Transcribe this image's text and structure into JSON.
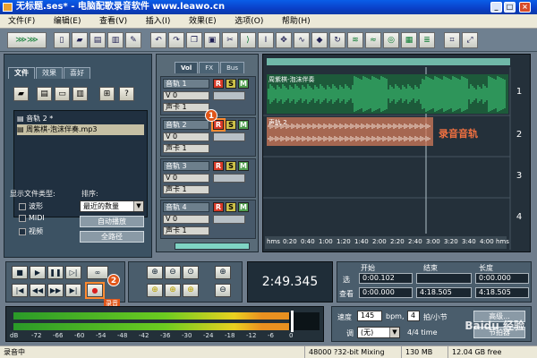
{
  "window": {
    "title": "无标题.ses* - 电脑配歌录音软件 www.leawo.cn",
    "min": "_",
    "max": "□",
    "close": "×"
  },
  "menu": [
    "文件(F)",
    "编辑(E)",
    "查看(V)",
    "插入(I)",
    "效果(E)",
    "选项(O)",
    "帮助(H)"
  ],
  "left_panel": {
    "tabs": [
      "文件",
      "效果",
      "喜好"
    ],
    "files": [
      "音轨 2 *",
      "周紫棋-泡沫伴奏.mp3"
    ],
    "show_type_label": "显示文件类型:",
    "sort_label": "排序:",
    "types": [
      "波形",
      "MIDI",
      "视频"
    ],
    "sort_value": "最近的数量",
    "btn_auto_play": "自动播放",
    "btn_full_path": "全路径"
  },
  "tracks_panel": {
    "tabs": [
      "Vol",
      "FX",
      "Bus"
    ],
    "tracks": [
      {
        "name": "音轨 1",
        "vol": "V 0",
        "out": "声卡 1"
      },
      {
        "name": "音轨 2",
        "vol": "V 0",
        "out": "声卡 1"
      },
      {
        "name": "音轨 3",
        "vol": "V 0",
        "out": "声卡 1"
      },
      {
        "name": "音轨 4",
        "vol": "V 0",
        "out": "声卡 1"
      }
    ],
    "r": "R",
    "s": "S",
    "m": "M"
  },
  "wave_panel": {
    "clip1_label": "周紫棋-泡沫伴奏",
    "clip2_label": "声轨 2",
    "record_track_label": "录音音轨",
    "lane_numbers": [
      "1",
      "2",
      "3",
      "4"
    ],
    "ruler": [
      "hms",
      "0:20",
      "0:40",
      "1:00",
      "1:20",
      "1:40",
      "2:00",
      "2:20",
      "2:40",
      "3:00",
      "3:20",
      "3:40",
      "4:00",
      "hms"
    ]
  },
  "markers": {
    "m1": "1",
    "m2": "2"
  },
  "transport": {
    "record_tooltip": "录音"
  },
  "time_display": "2:49.345",
  "selection": {
    "headers": [
      "开始",
      "结束",
      "长度"
    ],
    "row1_label": "选",
    "row2_label": "查看",
    "sel_start": "0:00.102",
    "sel_end": "",
    "sel_len": "0:00.000",
    "view_start": "0:00.000",
    "view_end": "4:18.505",
    "view_len": "4:18.505"
  },
  "bpm": {
    "tempo_label": "速度",
    "tempo_value": "145",
    "tempo_unit": "bpm,",
    "beats_value": "4",
    "beats_unit": "拍/小节",
    "key_label": "调",
    "key_value": "(无)",
    "time_sig": "4/4 time",
    "advanced_btn": "高级...",
    "metronome_btn": "节拍器"
  },
  "meter_scale": [
    "dB",
    "-72",
    "-66",
    "-60",
    "-54",
    "-48",
    "-42",
    "-36",
    "-30",
    "-24",
    "-18",
    "-12",
    "-6",
    "0"
  ],
  "status": [
    "录音中",
    "48000 ?32-bit Mixing",
    "130 MB",
    "12.04 GB free"
  ],
  "watermark": "Baidu 经验",
  "colors": {
    "wave_green": "#3fd07a",
    "record_red": "#d83a28",
    "meter_yellow": "#e8d020"
  }
}
